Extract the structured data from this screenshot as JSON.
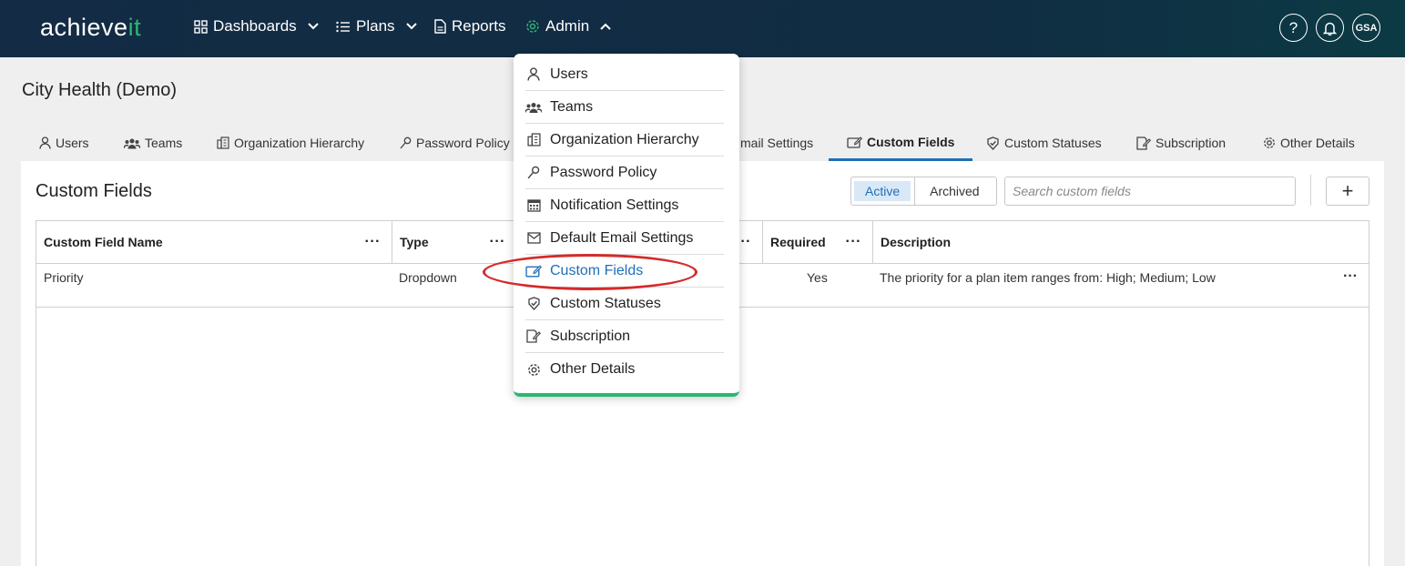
{
  "app": {
    "logo_main": "achieve",
    "logo_accent": "it",
    "nav": [
      {
        "label": "Dashboards"
      },
      {
        "label": "Plans"
      },
      {
        "label": "Reports"
      },
      {
        "label": "Admin"
      }
    ],
    "help_glyph": "?",
    "avatar_initials": "GSA"
  },
  "org_title": "City Health (Demo)",
  "tabs": [
    {
      "label": "Users",
      "icon": "user-icon"
    },
    {
      "label": "Teams",
      "icon": "teams-icon"
    },
    {
      "label": "Organization Hierarchy",
      "icon": "building-icon"
    },
    {
      "label": "Password Policy",
      "icon": "key-icon"
    },
    {
      "label": "mail Settings",
      "icon": "none"
    },
    {
      "label": "Custom Fields",
      "icon": "edit-field-icon"
    },
    {
      "label": "Custom Statuses",
      "icon": "badge-check-icon"
    },
    {
      "label": "Subscription",
      "icon": "subscription-icon"
    },
    {
      "label": "Other Details",
      "icon": "gear-icon"
    }
  ],
  "panel": {
    "title": "Custom Fields",
    "filter_active": "Active",
    "filter_archived": "Archived",
    "search_placeholder": "Search custom fields",
    "add_glyph": "+"
  },
  "table": {
    "columns": [
      "Custom Field Name",
      "Type",
      "Required",
      "Description"
    ],
    "menu_glyph": "···",
    "rows": [
      {
        "name": "Priority",
        "type": "Dropdown",
        "required": "Yes",
        "description": "The priority for a plan item ranges from: High; Medium; Low"
      }
    ]
  },
  "admin_menu": [
    {
      "label": "Users"
    },
    {
      "label": "Teams"
    },
    {
      "label": "Organization Hierarchy"
    },
    {
      "label": "Password Policy"
    },
    {
      "label": "Notification Settings"
    },
    {
      "label": "Default Email Settings"
    },
    {
      "label": "Custom Fields"
    },
    {
      "label": "Custom Statuses"
    },
    {
      "label": "Subscription"
    },
    {
      "label": "Other Details"
    }
  ],
  "colors": {
    "accent": "#1f6fb8",
    "brand_green": "#2bb673",
    "annotation_red": "#d42b2b",
    "topbar": "#132b44"
  }
}
